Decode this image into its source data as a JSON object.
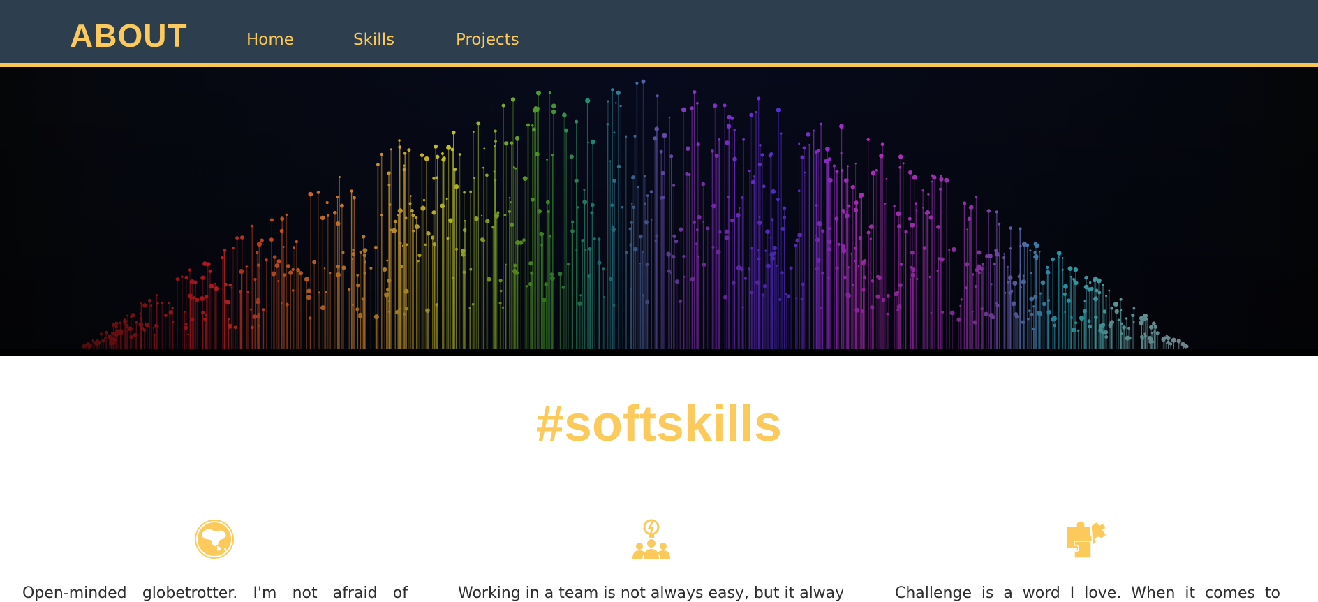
{
  "nav": {
    "brand": "ABOUT",
    "links": [
      "Home",
      "Skills",
      "Projects"
    ]
  },
  "colors": {
    "accent": "#fcc95b",
    "navbar": "#2d3e4e",
    "text": "#2d2d2d"
  },
  "section": {
    "title": "#softskills"
  },
  "skills": [
    {
      "icon": "globe-icon",
      "text": "Open-minded globetrotter. I'm not afraid of"
    },
    {
      "icon": "team-idea-icon",
      "text": "Working in a team is not always easy, but it always"
    },
    {
      "icon": "puzzle-icon",
      "text": "Challenge is a word I love. When it comes to"
    }
  ]
}
